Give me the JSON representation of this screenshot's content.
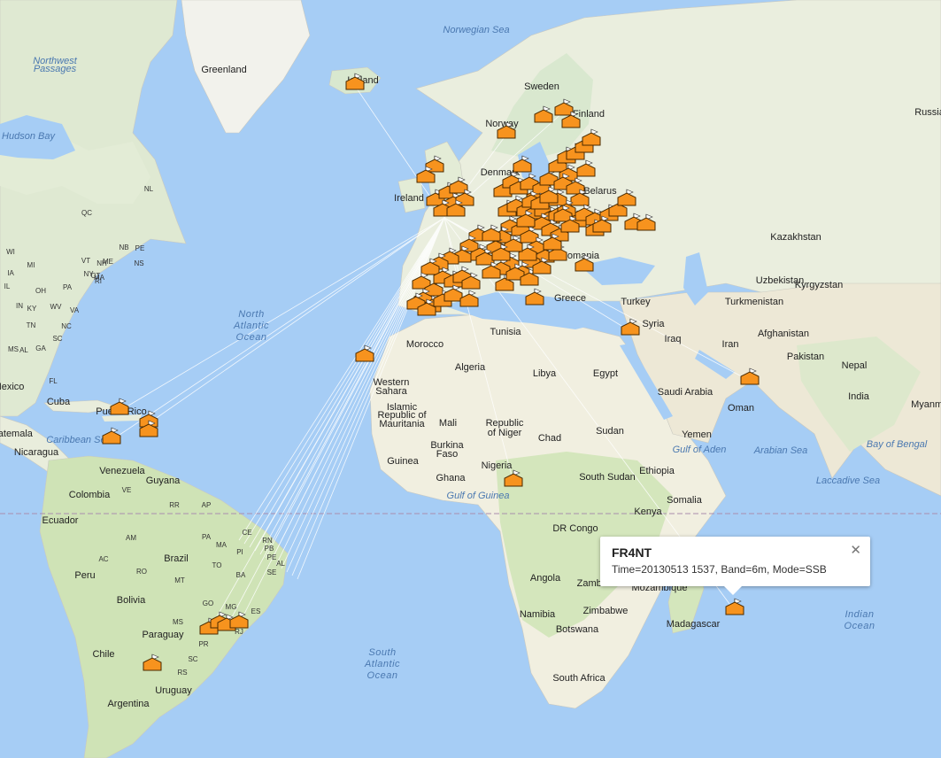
{
  "map": {
    "labels": {
      "countries": [
        "Greenland",
        "Iceland",
        "Sweden",
        "Norway",
        "Finland",
        "Ireland",
        "Denmark",
        "Belarus",
        "Romania",
        "Greece",
        "Turkey",
        "Syria",
        "Iraq",
        "Iran",
        "Afghanistan",
        "Pakistan",
        "India",
        "Nepal",
        "Kazakhstan",
        "Uzbekistan",
        "Kyrgyzstan",
        "Turkmenistan",
        "Russia",
        "Morocco",
        "Algeria",
        "Libya",
        "Egypt",
        "Tunisia",
        "Western Sahara",
        "Islamic Republic of Mauritania",
        "Mali",
        "Republic of Niger",
        "Chad",
        "Sudan",
        "Burkina Faso",
        "Guinea",
        "Ghana",
        "Nigeria",
        "South Sudan",
        "Ethiopia",
        "Somalia",
        "Kenya",
        "DR Congo",
        "Angola",
        "Zambia",
        "Mozambique",
        "Namibia",
        "Zimbabwe",
        "Botswana",
        "Madagascar",
        "South Africa",
        "Saudi Arabia",
        "Yemen",
        "Oman",
        "Venezuela",
        "Colombia",
        "Ecuador",
        "Guyana",
        "Peru",
        "Brazil",
        "Bolivia",
        "Paraguay",
        "Chile",
        "Argentina",
        "Uruguay",
        "Cuba",
        "Puerto Rico",
        "Nicaragua",
        "Guatemala",
        "Mexico",
        "Myanmar"
      ],
      "states": [
        "NL",
        "QC",
        "NB",
        "PE",
        "NS",
        "ME",
        "MI",
        "OH",
        "PA",
        "NY",
        "VT",
        "IL",
        "IN",
        "WV",
        "VA",
        "KY",
        "NC",
        "TN",
        "SC",
        "MS",
        "AL",
        "GA",
        "FL",
        "CT",
        "RI",
        "IA",
        "WI",
        "MA",
        "NH",
        "VE",
        "RR",
        "AP",
        "AM",
        "PA",
        "MA",
        "CE",
        "RN",
        "PB",
        "PE",
        "AL",
        "SE",
        "BA",
        "TO",
        "PI",
        "MT",
        "RO",
        "AC",
        "GO",
        "MG",
        "ES",
        "MS",
        "SP",
        "RJ",
        "PR",
        "SC",
        "RS"
      ],
      "seas": [
        "Norwegian Sea",
        "Hudson Bay",
        "Northwest Passages",
        "Caribbean Sea",
        "Gulf of Guinea",
        "Gulf of Aden",
        "Arabian Sea",
        "Bay of Bengal",
        "Laccadive Sea"
      ],
      "oceans": [
        "North Atlantic Ocean",
        "South Atlantic Ocean",
        "Indian Ocean"
      ]
    },
    "marker_color": "#f7931e",
    "marker_count": 120
  },
  "infowindow": {
    "callsign": "FR4NT",
    "details": "Time=20130513 1537, Band=6m, Mode=SSB",
    "close_icon": "close-icon"
  }
}
